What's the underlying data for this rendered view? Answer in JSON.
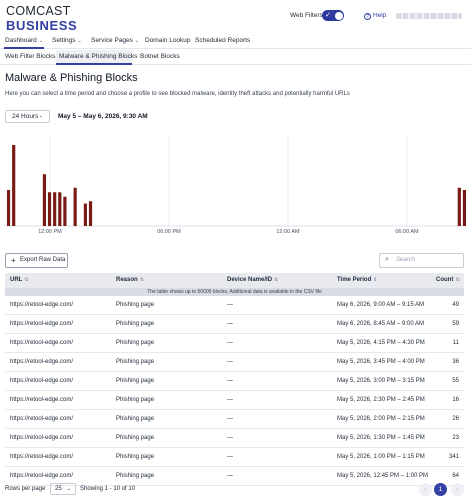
{
  "brand": {
    "line1": "COMCAST",
    "line2": "BUSINESS"
  },
  "topbar": {
    "web_filters_label": "Web Filters",
    "web_filters_on": true,
    "help_label": "Help",
    "user_label": ""
  },
  "nav": {
    "items": [
      {
        "label": "Dashboard",
        "caret": "⌄"
      },
      {
        "label": "Settings",
        "caret": "⌄"
      },
      {
        "label": "Service Pages",
        "caret": "⌄"
      },
      {
        "label": "Domain Lookup"
      },
      {
        "label": "Scheduled Reports"
      }
    ]
  },
  "subnav": {
    "items": [
      "Web Filter Blocks",
      "Malware & Phishing Blocks",
      "Botnet Blocks"
    ]
  },
  "page": {
    "title": "Malware & Phishing Blocks",
    "description": "Here you can select a time period and choose a profile to see blocked malware, identity theft attacks and potentially harmful URLs",
    "period": "24 Hours",
    "range": "May 5 – May 6, 2026, 9:30 AM"
  },
  "colors": {
    "accent": "#3340a4",
    "bar": "#7a1a14"
  },
  "chart_data": {
    "type": "bar",
    "x_ticks": [
      "12:00 PM",
      "06:00 PM",
      "12:00 AM",
      "06:00 AM"
    ],
    "values": [
      16,
      36,
      0,
      0,
      0,
      0,
      0,
      23,
      15,
      15,
      15,
      13,
      0,
      17,
      0,
      10,
      11,
      0,
      0,
      0,
      0,
      0,
      0,
      0,
      0,
      0,
      0,
      0,
      0,
      0,
      0,
      0,
      0,
      0,
      0,
      0,
      0,
      0,
      0,
      0,
      0,
      0,
      0,
      0,
      0,
      0,
      0,
      0,
      0,
      0,
      0,
      0,
      0,
      0,
      0,
      0,
      0,
      0,
      0,
      0,
      0,
      0,
      0,
      0,
      0,
      0,
      0,
      0,
      0,
      0,
      0,
      0,
      0,
      0,
      0,
      0,
      0,
      0,
      0,
      0,
      0,
      0,
      0,
      0,
      0,
      0,
      0,
      0,
      17,
      16
    ],
    "ylim": [
      0,
      40
    ],
    "grid": true
  },
  "actions": {
    "export_label": "Export Raw Data",
    "search_placeholder": "Search"
  },
  "table": {
    "columns": [
      "URL",
      "Reason",
      "Device Name/ID",
      "Time Period",
      "Count"
    ],
    "note": "The table shows up to 50000 blocks. Additional data is available in the CSV file",
    "rows": [
      {
        "url": "https://retool-edge.com/",
        "reason": "Phishing page",
        "device": "—",
        "time": "May 6, 2026, 9:00 AM – 9:15 AM",
        "count": "49"
      },
      {
        "url": "https://retool-edge.com/",
        "reason": "Phishing page",
        "device": "—",
        "time": "May 6, 2026, 8:45 AM – 9:00 AM",
        "count": "59"
      },
      {
        "url": "https://retool-edge.com/",
        "reason": "Phishing page",
        "device": "—",
        "time": "May 5, 2026, 4:15 PM – 4:30 PM",
        "count": "11"
      },
      {
        "url": "https://retool-edge.com/",
        "reason": "Phishing page",
        "device": "—",
        "time": "May 5, 2026, 3:45 PM – 4:00 PM",
        "count": "36"
      },
      {
        "url": "https://retool-edge.com/",
        "reason": "Phishing page",
        "device": "—",
        "time": "May 5, 2026, 3:00 PM – 3:15 PM",
        "count": "55"
      },
      {
        "url": "https://retool-edge.com/",
        "reason": "Phishing page",
        "device": "—",
        "time": "May 5, 2026, 2:30 PM – 2:45 PM",
        "count": "16"
      },
      {
        "url": "https://retool-edge.com/",
        "reason": "Phishing page",
        "device": "—",
        "time": "May 5, 2026, 2:00 PM – 2:15 PM",
        "count": "26"
      },
      {
        "url": "https://retool-edge.com/",
        "reason": "Phishing page",
        "device": "—",
        "time": "May 5, 2026, 1:30 PM – 1:45 PM",
        "count": "23"
      },
      {
        "url": "https://retool-edge.com/",
        "reason": "Phishing page",
        "device": "—",
        "time": "May 5, 2026, 1:00 PM – 1:15 PM",
        "count": "341"
      },
      {
        "url": "https://retool-edge.com/",
        "reason": "Phishing page",
        "device": "—",
        "time": "May 5, 2026, 12:45 PM – 1:00 PM",
        "count": "64"
      }
    ]
  },
  "pagination": {
    "rows_per_page_label": "Rows per page",
    "rows_per_page": "25",
    "showing": "Showing 1 - 10 of 10",
    "current_page": "1",
    "prev": "‹",
    "next": "›"
  },
  "icons": {
    "sort": "⇅",
    "sort_active": "⇩",
    "search": "⌕",
    "plus": "+",
    "check": "✓",
    "help": "?"
  }
}
